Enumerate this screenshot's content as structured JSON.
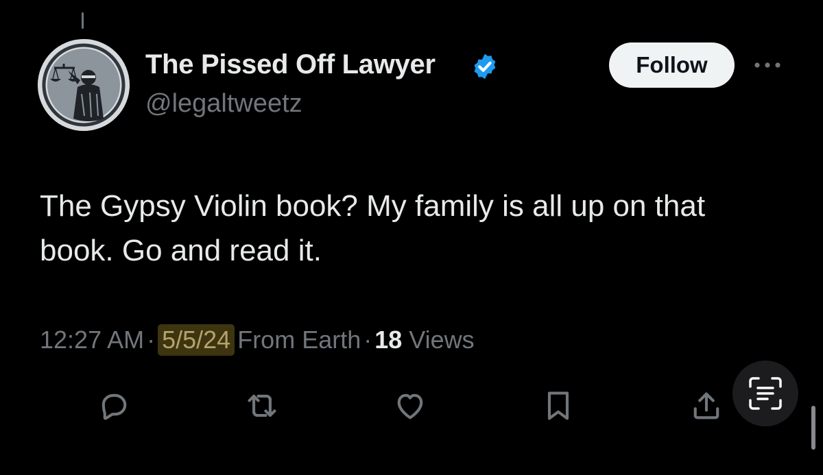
{
  "author": {
    "display_name": "The Pissed Off Lawyer",
    "handle": "@legaltweetz",
    "verified": true
  },
  "header": {
    "follow_label": "Follow"
  },
  "tweet": {
    "text": "The Gypsy Violin book? My family is all up on that book. Go and read it.",
    "time": "12:27 AM",
    "date": "5/5/24",
    "source": "From Earth",
    "views_count": "18",
    "views_label": "Views",
    "separator": "·"
  },
  "actions": {
    "icons": [
      "reply-icon",
      "retweet-icon",
      "like-icon",
      "bookmark-icon",
      "share-icon"
    ]
  },
  "colors": {
    "background": "#000000",
    "primary_text": "#e7e9ea",
    "secondary_text": "#71767b",
    "verified_blue": "#1d9bf0",
    "follow_button_bg": "#eff3f4",
    "date_highlight_bg": "#3d3410"
  }
}
